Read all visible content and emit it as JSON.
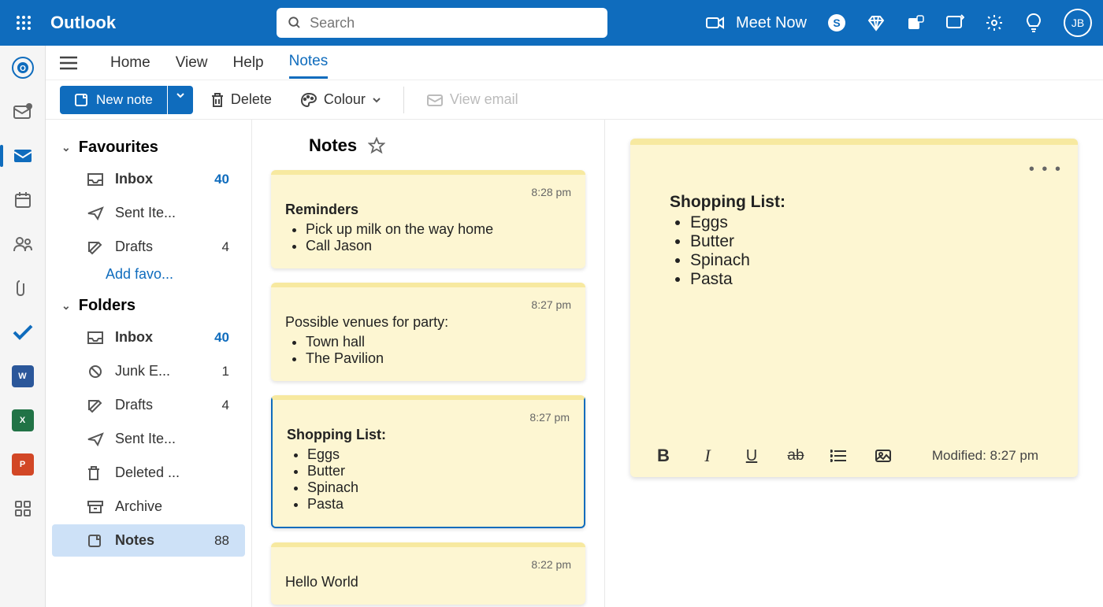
{
  "header": {
    "app_name": "Outlook",
    "search_placeholder": "Search",
    "meet_now": "Meet Now",
    "avatar_initials": "JB"
  },
  "tabs": {
    "home": "Home",
    "view": "View",
    "help": "Help",
    "notes": "Notes"
  },
  "toolbar": {
    "new_note": "New note",
    "delete": "Delete",
    "colour": "Colour",
    "view_email": "View email"
  },
  "folders": {
    "favourites_label": "Favourites",
    "folders_label": "Folders",
    "add_favourites": "Add favo...",
    "inbox": "Inbox",
    "inbox_count": "40",
    "sent": "Sent Ite...",
    "drafts": "Drafts",
    "drafts_count": "4",
    "junk": "Junk E...",
    "junk_count": "1",
    "deleted": "Deleted ...",
    "archive": "Archive",
    "notes": "Notes",
    "notes_count": "88"
  },
  "notes_list": {
    "header": "Notes",
    "items": [
      {
        "time": "8:28 pm",
        "title": "Reminders",
        "bullets": [
          "Pick up milk on the way home",
          "Call Jason"
        ],
        "bold_title": true
      },
      {
        "time": "8:27 pm",
        "title": "Possible venues for party:",
        "bullets": [
          "Town hall",
          "The Pavilion"
        ],
        "bold_title": false
      },
      {
        "time": "8:27 pm",
        "title": "Shopping List:",
        "bullets": [
          "Eggs",
          "Butter",
          "Spinach",
          "Pasta"
        ],
        "bold_title": true,
        "selected": true
      },
      {
        "time": "8:22 pm",
        "title": "Hello World",
        "bullets": [],
        "bold_title": false
      }
    ]
  },
  "reading": {
    "title": "Shopping List:",
    "bullets": [
      "Eggs",
      "Butter",
      "Spinach",
      "Pasta"
    ],
    "modified": "Modified: 8:27 pm"
  }
}
